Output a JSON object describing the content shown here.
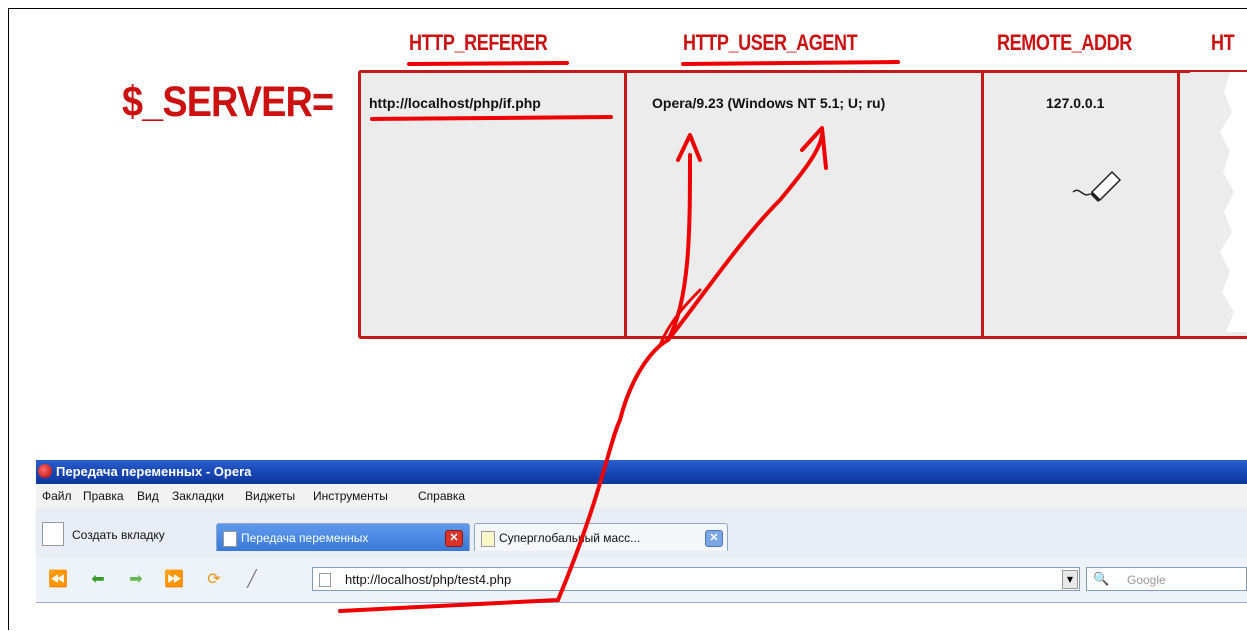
{
  "diagram": {
    "server_label": "$_SERVER=",
    "columns": [
      {
        "header": "HTTP_REFERER",
        "value": "http://localhost/php/if.php"
      },
      {
        "header": "HTTP_USER_AGENT",
        "value": "Opera/9.23 (Windows NT 5.1; U; ru)"
      },
      {
        "header": "REMOTE_ADDR",
        "value": "127.0.0.1"
      },
      {
        "header": "HT",
        "value": ""
      }
    ]
  },
  "browser": {
    "title": "Передача переменных - Opera",
    "menu": [
      "Файл",
      "Правка",
      "Вид",
      "Закладки",
      "Виджеты",
      "Инструменты",
      "Справка"
    ],
    "new_tab_label": "Создать вкладку",
    "tabs": [
      {
        "label": "Передача переменных",
        "active": true
      },
      {
        "label": "Суперглобальный масс...",
        "active": false
      }
    ],
    "nav_icons": [
      "rewind-icon",
      "back-icon",
      "forward-icon",
      "fast-forward-icon",
      "reload-icon",
      "edit-icon"
    ],
    "address": "http://localhost/php/test4.php",
    "search_placeholder": "Google"
  },
  "colors": {
    "annotation_red": "#ee0000",
    "table_border": "#c01a1a",
    "title_bar": "#1746b4"
  }
}
